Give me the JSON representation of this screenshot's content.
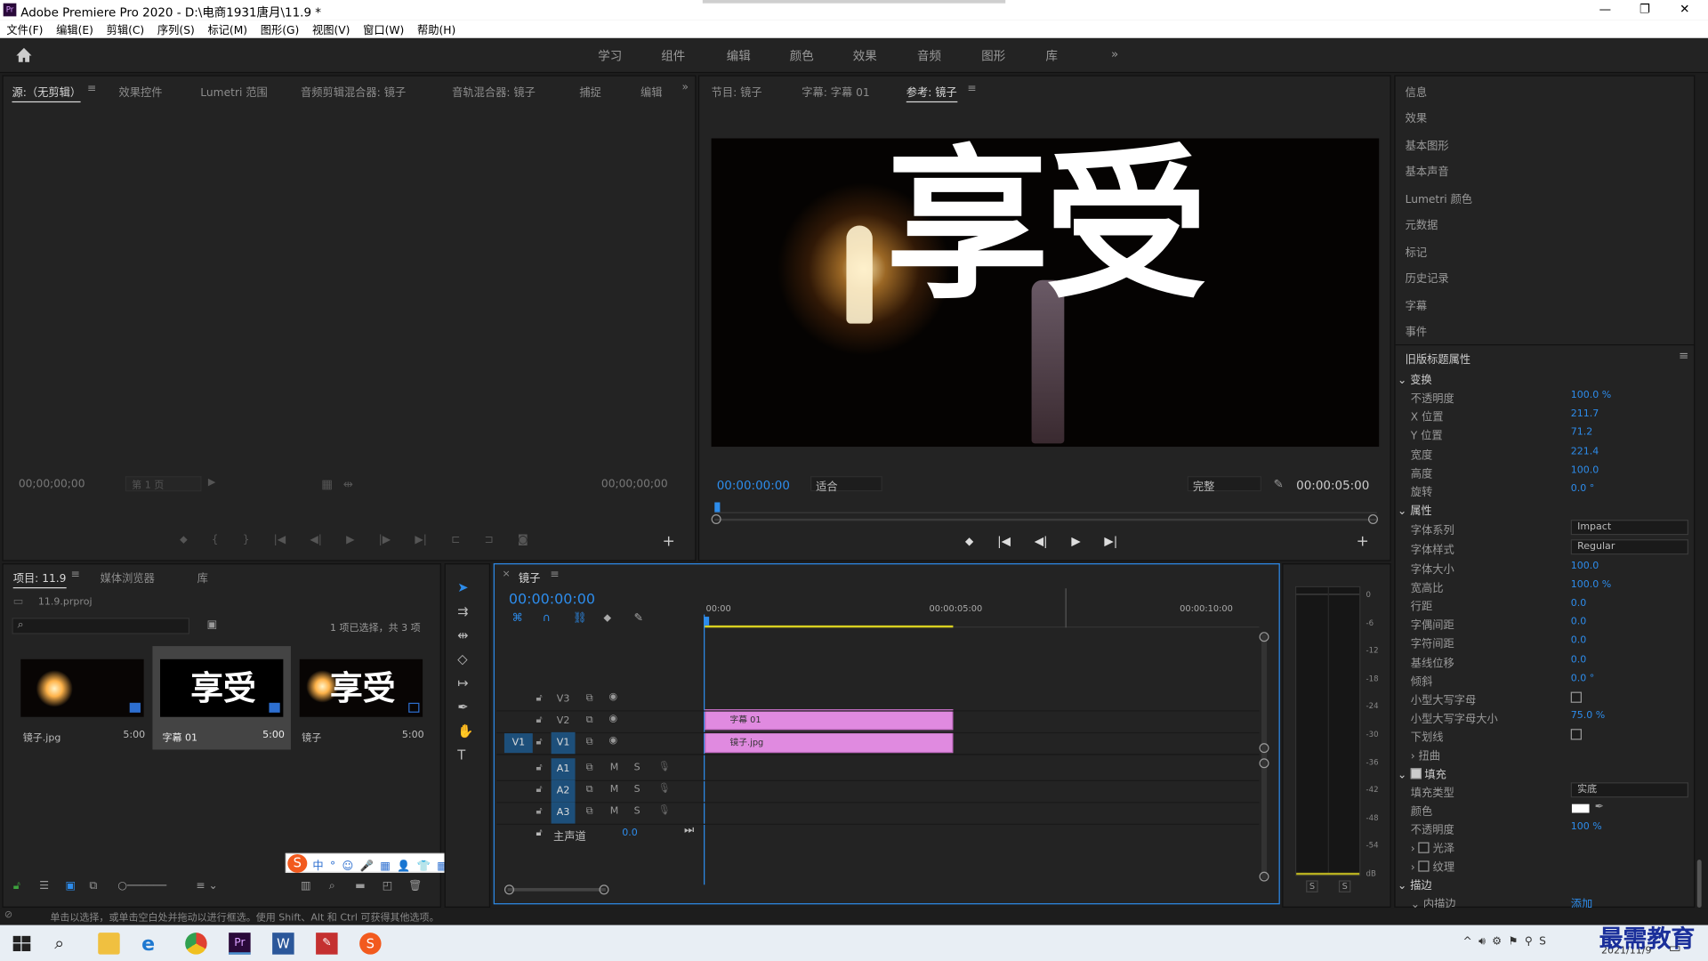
{
  "window": {
    "title": "Adobe Premiere Pro 2020 - D:\\电商1931唐月\\11.9 *",
    "controls": [
      "—",
      "❐",
      "✕"
    ]
  },
  "menu": [
    "文件(F)",
    "编辑(E)",
    "剪辑(C)",
    "序列(S)",
    "标记(M)",
    "图形(G)",
    "视图(V)",
    "窗口(W)",
    "帮助(H)"
  ],
  "workspaces": [
    "学习",
    "组件",
    "编辑",
    "颜色",
    "效果",
    "音频",
    "图形",
    "库"
  ],
  "source_panel": {
    "tabs": [
      "源:（无剪辑）",
      "效果控件",
      "Lumetri 范围",
      "音频剪辑混合器: 镜子",
      "音轨混合器: 镜子",
      "捕捉",
      "编辑"
    ],
    "timecode_in": "00;00;00;00",
    "timecode_out": "00;00;00;00",
    "page": "第 1 页"
  },
  "program_panel": {
    "tabs": [
      "节目: 镜子",
      "字幕: 字幕 01",
      "参考: 镜子"
    ],
    "timecode": "00:00:00:00",
    "fit": "适合",
    "quality": "完整",
    "duration": "00:00:05:00",
    "title_text": "享受"
  },
  "right_panels": [
    "信息",
    "效果",
    "基本图形",
    "基本声音",
    "Lumetri 颜色",
    "元数据",
    "标记",
    "历史记录",
    "字幕",
    "事件"
  ],
  "legacy_title": {
    "header": "旧版标题属性",
    "transform_label": "变换",
    "transform": [
      {
        "k": "不透明度",
        "v": "100.0 %"
      },
      {
        "k": "X 位置",
        "v": "211.7"
      },
      {
        "k": "Y 位置",
        "v": "71.2"
      },
      {
        "k": "宽度",
        "v": "221.4"
      },
      {
        "k": "高度",
        "v": "100.0"
      },
      {
        "k": "旋转",
        "v": "0.0 °"
      }
    ],
    "props_label": "属性",
    "font_family_label": "字体系列",
    "font_family": "Impact",
    "font_style_label": "字体样式",
    "font_style": "Regular",
    "props": [
      {
        "k": "字体大小",
        "v": "100.0"
      },
      {
        "k": "宽高比",
        "v": "100.0 %"
      },
      {
        "k": "行距",
        "v": "0.0"
      },
      {
        "k": "字偶间距",
        "v": "0.0"
      },
      {
        "k": "字符间距",
        "v": "0.0"
      },
      {
        "k": "基线位移",
        "v": "0.0"
      },
      {
        "k": "倾斜",
        "v": "0.0 °"
      }
    ],
    "smallcaps": "小型大写字母",
    "smallcaps_size": "小型大写字母大小",
    "smallcaps_size_v": "75.0 %",
    "underline": "下划线",
    "distort": "扭曲",
    "fill_label": "填充",
    "fill_type_label": "填充类型",
    "fill_type": "实底",
    "color_label": "颜色",
    "opacity_label": "不透明度",
    "opacity": "100 %",
    "sheen": "光泽",
    "texture": "纹理",
    "stroke_label": "描边",
    "inner_stroke": "内描边",
    "add": "添加"
  },
  "project": {
    "tabs": [
      "项目: 11.9",
      "媒体浏览器",
      "库"
    ],
    "file": "11.9.prproj",
    "selection": "1 项已选择，共 3 项",
    "items": [
      {
        "name": "镜子.jpg",
        "dur": "5:00"
      },
      {
        "name": "字幕 01",
        "dur": "5:00"
      },
      {
        "name": "镜子",
        "dur": "5:00"
      }
    ]
  },
  "timeline": {
    "tab": "镜子",
    "timecode": "00:00:00:00",
    "ruler": [
      "00:00",
      "00:00:05:00",
      "00:00:10:00"
    ],
    "video_tracks": [
      "V3",
      "V2",
      "V1"
    ],
    "audio_tracks": [
      "A1",
      "A2",
      "A3"
    ],
    "master": "主声道",
    "master_val": "0.0",
    "clips": [
      {
        "name": "字幕 01"
      },
      {
        "name": "镜子.jpg"
      }
    ],
    "src_v1": "V1"
  },
  "meter": {
    "scale": [
      "0",
      "-6",
      "-12",
      "-18",
      "-24",
      "-30",
      "-36",
      "-42",
      "-48",
      "-54",
      "dB"
    ],
    "solo": [
      "S",
      "S"
    ]
  },
  "status": "单击以选择，或单击空白处并拖动以进行框选。使用 Shift、Alt 和 Ctrl 可获得其他选项。",
  "taskbar": {
    "date": "2021/11/9",
    "watermark": "最需教育"
  }
}
